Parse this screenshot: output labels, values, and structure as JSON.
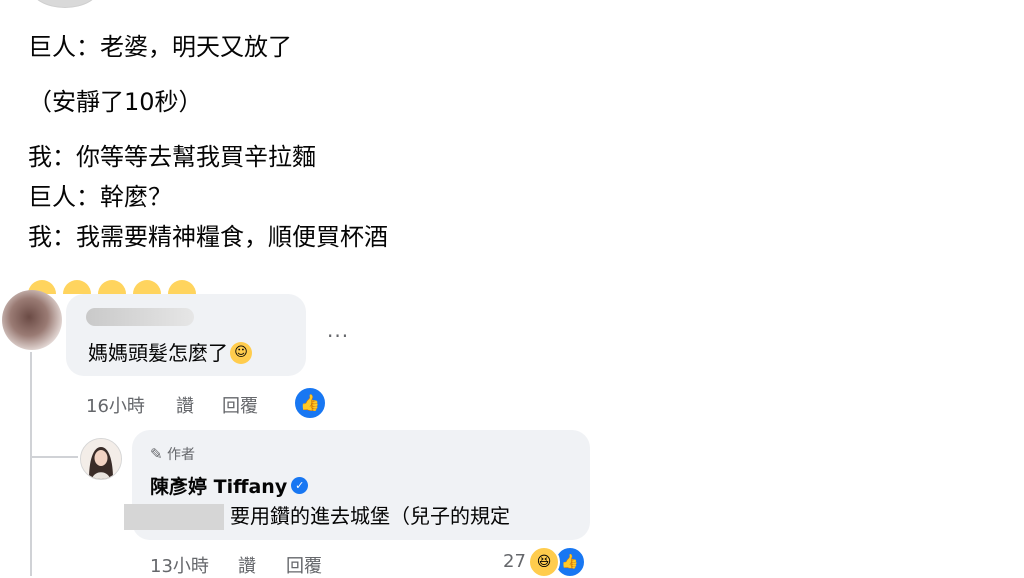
{
  "post": {
    "lines": [
      "巨人：老婆，明天又放了",
      "（安靜了10秒）",
      "我：你等等去幫我買辛拉麵",
      "巨人：幹麼？",
      "我：我需要精神糧食，順便買杯酒"
    ]
  },
  "comment1": {
    "text": "媽媽頭髮怎麼了",
    "more": "···",
    "time": "16小時",
    "like_label": "讚",
    "reply_label": "回覆",
    "reaction_icon": "thumbs-up-icon"
  },
  "comment2": {
    "author_tag": "作者",
    "author_name": "陳彥婷 Tiffany",
    "text": "要用鑽的進去城堡（兒子的規定",
    "time": "13小時",
    "like_label": "讚",
    "reply_label": "回覆",
    "reaction_count": "27",
    "reaction_icons": [
      "haha-icon",
      "thumbs-up-icon"
    ]
  },
  "colors": {
    "bubble": "#f0f2f5",
    "meta_text": "#65676b",
    "facebook_blue": "#1877f2"
  }
}
